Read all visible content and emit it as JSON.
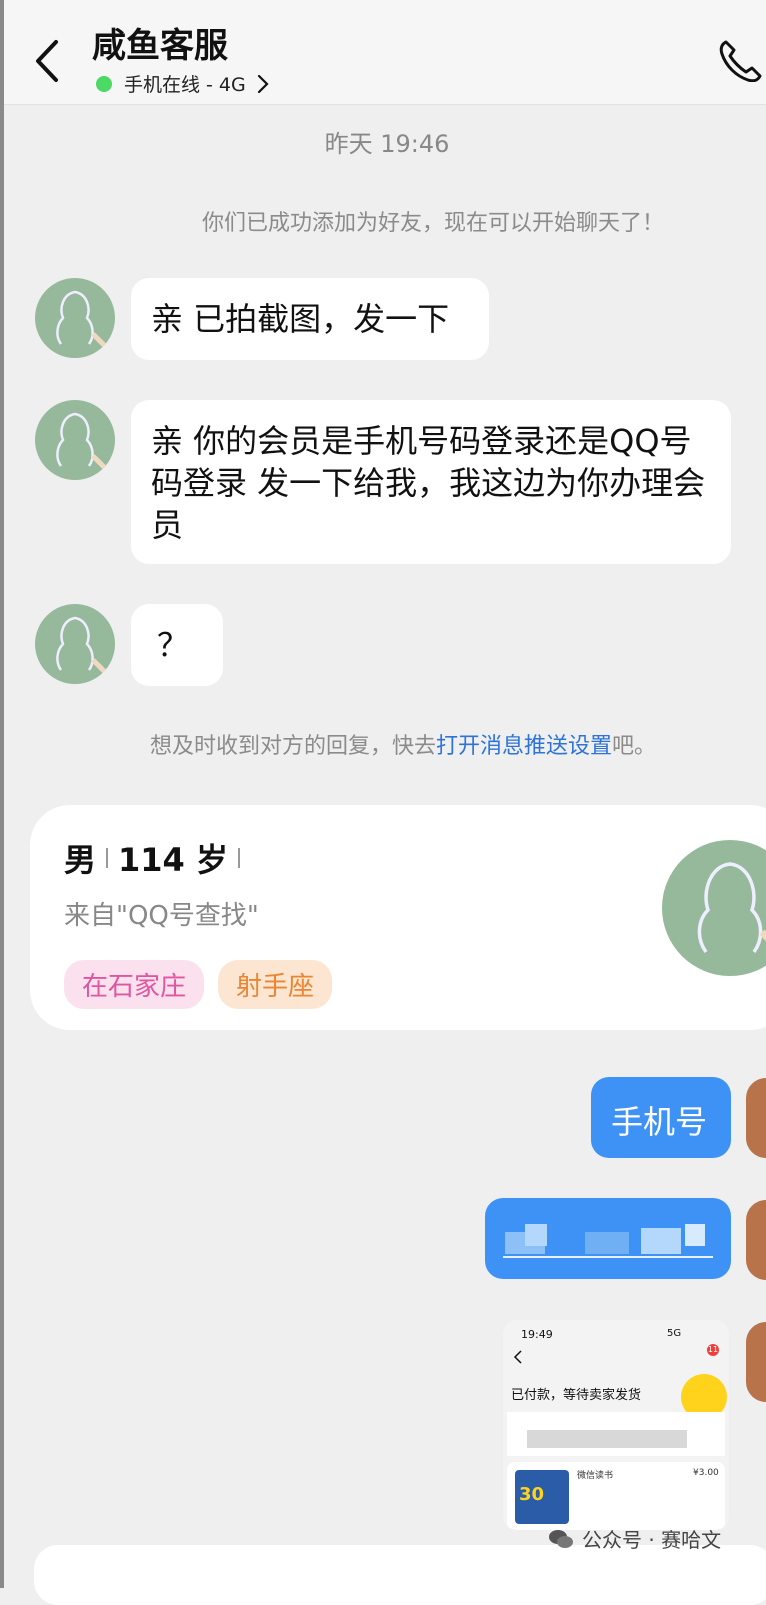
{
  "header": {
    "title": "咸鱼客服",
    "status": "手机在线 - 4G"
  },
  "timestamp": "昨天 19:46",
  "friend_added": "你们已成功添加为好友，现在可以开始聊天了！",
  "messages": [
    {
      "text": "亲 已拍截图，发一下"
    },
    {
      "text": "亲 你的会员是手机号码登录还是QQ号码登录 发一下给我，我这边为你办理会员"
    },
    {
      "text": "？"
    }
  ],
  "push_hint": {
    "prefix": "想及时收到对方的回复，快去",
    "link": "打开消息推送设置",
    "suffix": "吧。"
  },
  "profile_card": {
    "gender": "男",
    "age": "114 岁",
    "source": "来自\"QQ号查找\"",
    "tags": [
      "在石家庄",
      "射手座"
    ]
  },
  "my_messages": [
    {
      "text": "手机号"
    }
  ],
  "shared_screenshot": {
    "time": "19:49",
    "signal": "5G",
    "badge": "11",
    "order_status": "已付款，等待卖家发货",
    "product_name": "微信读书",
    "price": "¥3.00",
    "product_badge": "30"
  },
  "watermark": "公众号 · 赛哈文",
  "colors": {
    "accent_blue": "#3f92f5",
    "online_green": "#4cd964",
    "link_blue": "#2e74d8",
    "tag_pink": "#e055a0",
    "tag_orange": "#e98533"
  },
  "icons": {
    "back": "chevron-left-icon",
    "call": "phone-icon",
    "status_chevron": "chevron-right-icon"
  }
}
